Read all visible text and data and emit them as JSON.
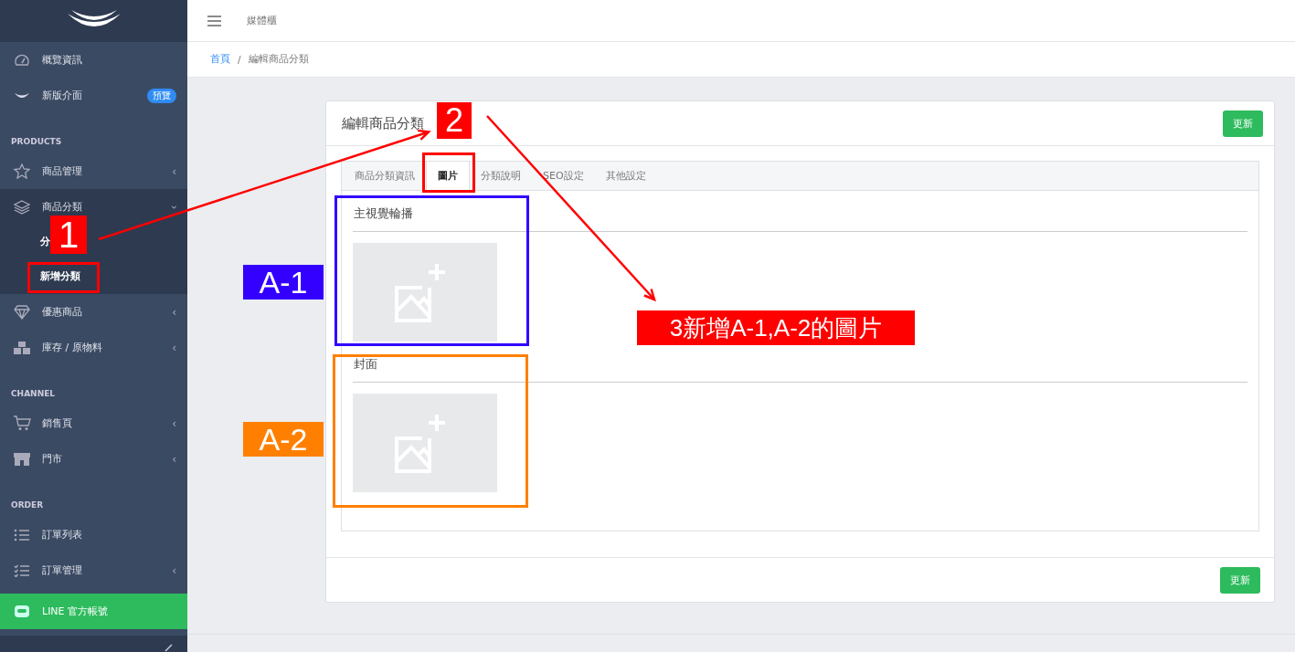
{
  "sidebar": {
    "items": [
      {
        "kind": "item",
        "label": "概覽資訊",
        "expanded": false
      },
      {
        "kind": "item",
        "label": "新版介面",
        "badge": "預覽",
        "expanded": false
      },
      {
        "kind": "section",
        "label": "PRODUCTS"
      },
      {
        "kind": "item",
        "label": "商品管理",
        "caret": "‹",
        "expanded": false
      },
      {
        "kind": "item",
        "label": "商品分類",
        "caret": "‹",
        "expanded": true,
        "children": [
          {
            "label": "分"
          },
          {
            "label": "新增分類"
          }
        ]
      },
      {
        "kind": "item",
        "label": "優惠商品",
        "caret": "‹",
        "expanded": false
      },
      {
        "kind": "item",
        "label": "庫存 / 原物料",
        "caret": "‹",
        "expanded": false
      },
      {
        "kind": "section",
        "label": "CHANNEL"
      },
      {
        "kind": "item",
        "label": "銷售頁",
        "caret": "‹",
        "expanded": false
      },
      {
        "kind": "item",
        "label": "門市",
        "caret": "‹",
        "expanded": false
      },
      {
        "kind": "section",
        "label": "ORDER"
      },
      {
        "kind": "item",
        "label": "訂單列表",
        "expanded": false
      },
      {
        "kind": "item",
        "label": "訂單管理",
        "caret": "‹",
        "expanded": false
      },
      {
        "kind": "line",
        "label": "LINE 官方帳號"
      }
    ]
  },
  "header": {
    "title": "媒體櫃"
  },
  "breadcrumb": [
    {
      "kind": "link",
      "label": "首頁"
    },
    {
      "kind": "separator",
      "label": "/"
    },
    {
      "kind": "text",
      "label": "編輯商品分類"
    }
  ],
  "card": {
    "title": "編輯商品分類",
    "button": "更新",
    "tabs": [
      {
        "label": "商品分類資訊",
        "selected": false
      },
      {
        "label": "圖片",
        "selected": true
      },
      {
        "label": "分類說明",
        "selected": false
      },
      {
        "label": "SEO設定",
        "selected": false
      },
      {
        "label": "其他設定",
        "selected": false
      }
    ],
    "sections": [
      {
        "title": "主視覺輪播"
      },
      {
        "title": "封面"
      }
    ],
    "footer_button": "更新"
  },
  "annotations": {
    "boxes": [
      {
        "color": "#ff0000"
      },
      {
        "color": "#ff0000"
      },
      {
        "color": "#3300ff"
      },
      {
        "color": "#ff8000"
      }
    ],
    "labels": [
      {
        "text": "1",
        "color": "#ff0000"
      },
      {
        "text": "2",
        "color": "#ff0000"
      },
      {
        "text": "A-1",
        "color": "#3300ff"
      },
      {
        "text": "A-2",
        "color": "#ff8000"
      },
      {
        "text": "3新增A-1,A-2的圖片",
        "color": "#ff0000"
      }
    ],
    "arrows": [
      {
        "color": "#ff0000"
      },
      {
        "color": "#ff0000"
      }
    ]
  }
}
